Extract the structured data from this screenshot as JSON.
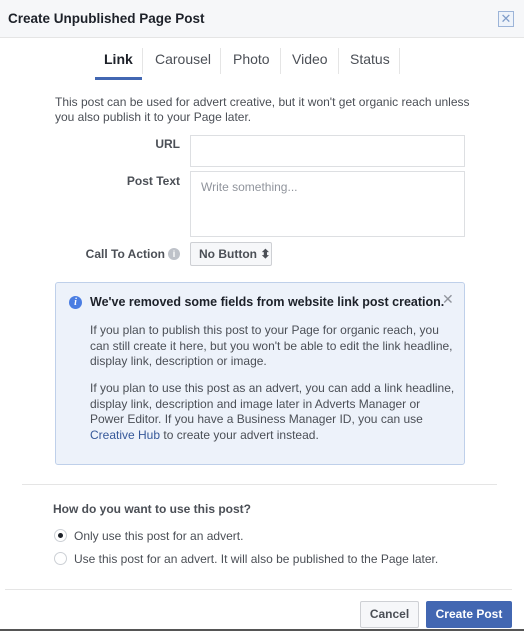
{
  "dialog": {
    "title": "Create Unpublished Page Post",
    "close_icon": "close-icon"
  },
  "tabs": [
    {
      "label": "Link",
      "active": true
    },
    {
      "label": "Carousel"
    },
    {
      "label": "Photo"
    },
    {
      "label": "Video"
    },
    {
      "label": "Status"
    }
  ],
  "description": "This post can be used for advert creative, but it won't get organic reach unless you also publish it to your Page later.",
  "form": {
    "url_label": "URL",
    "url_value": "",
    "post_text_label": "Post Text",
    "post_text_placeholder": "Write something...",
    "cta_label": "Call To Action",
    "cta_value": "No Button ⬍"
  },
  "notice": {
    "title": "We've removed some fields from website link post creation.",
    "p1": "If you plan to publish this post to your Page for organic reach, you can still create it here, but you won't be able to edit the link headline, display link, description or image.",
    "p2_before": "If you plan to use this post as an advert, you can add a link headline, display link, description and image later in Adverts Manager or Power Editor. If you have a Business Manager ID, you can use ",
    "p2_link": "Creative Hub",
    "p2_after": " to create your advert instead."
  },
  "usage": {
    "question": "How do you want to use this post?",
    "options": [
      {
        "label": "Only use this post for an advert.",
        "selected": true
      },
      {
        "label": "Use this post for an advert. It will also be published to the Page later.",
        "selected": false
      }
    ]
  },
  "footer": {
    "cancel": "Cancel",
    "create": "Create Post"
  },
  "colors": {
    "accent": "#4267b2",
    "notice_bg": "#edf2fa"
  }
}
